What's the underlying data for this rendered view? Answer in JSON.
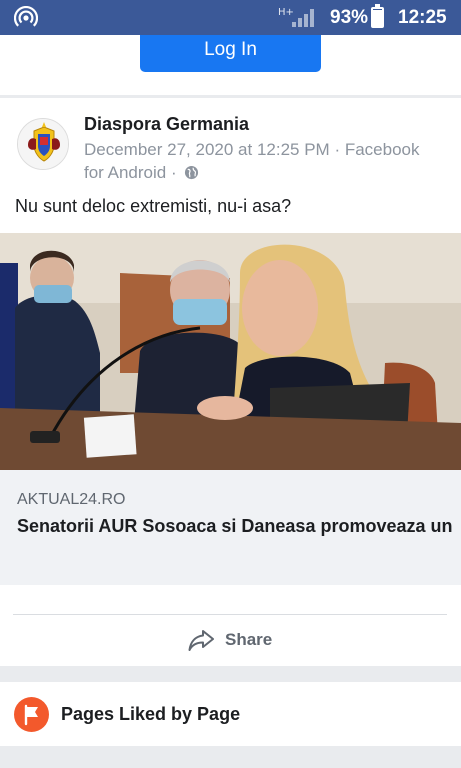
{
  "status_bar": {
    "network_label": "H+",
    "battery_percent": "93%",
    "battery_level": 0.93,
    "time": "12:25",
    "icons": [
      "hotspot-icon",
      "signal-icon",
      "battery-icon"
    ]
  },
  "login": {
    "button_label": "Log In"
  },
  "post": {
    "page_name": "Diaspora Germania",
    "date": "December 27, 2020 at 12:25 PM",
    "separator": "·",
    "source": "Facebook for Android",
    "text": "Nu sunt deloc extremisti, nu-i asa?",
    "link": {
      "domain": "AKTUAL24.RO",
      "title": "Senatorii AUR Sosoaca si Daneasa promoveaza un site rasist cu accente naziste..."
    },
    "share_label": "Share"
  },
  "pages_liked": {
    "label": "Pages Liked by Page"
  },
  "colors": {
    "status_bar": "#3b5998",
    "primary_button": "#1877f2",
    "pages_liked_icon": "#f3592c"
  }
}
